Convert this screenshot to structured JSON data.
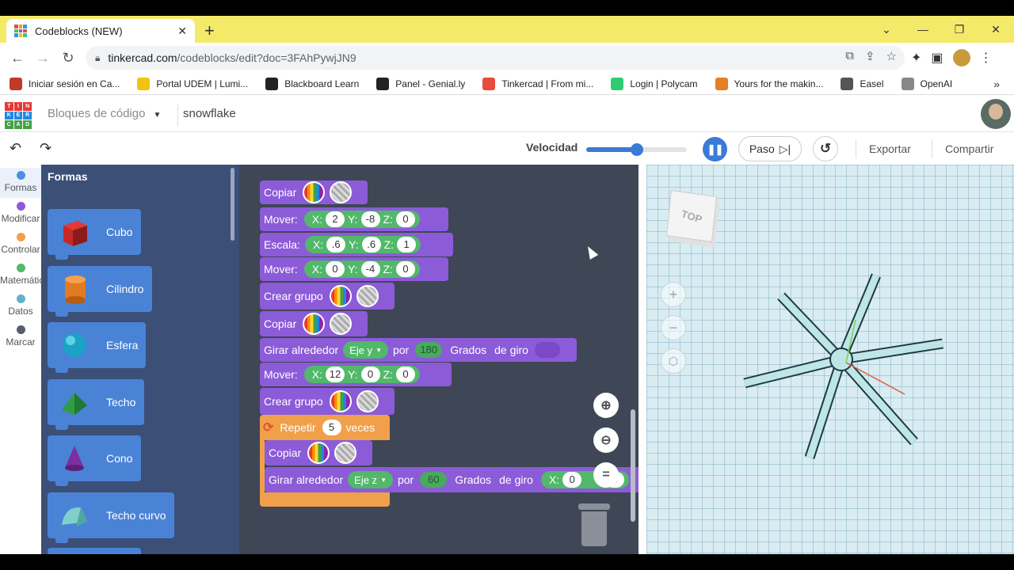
{
  "browser": {
    "tab_title": "Codeblocks (NEW)",
    "url_host": "tinkercad.com",
    "url_path": "/codeblocks/edit?doc=3FAhPywjJN9",
    "bookmarks": [
      "Iniciar sesión en Ca...",
      "Portal UDEM | Lumi...",
      "Blackboard Learn",
      "Panel - Genial.ly",
      "Tinkercad | From mi...",
      "Login | Polycam",
      "Yours for the makin...",
      "Easel",
      "OpenAI"
    ],
    "bookmark_colors": [
      "#c0392b",
      "#f1c40f",
      "#222222",
      "#222222",
      "#e74c3c",
      "#2ecc71",
      "#e67e22",
      "#555555",
      "#888888"
    ]
  },
  "app": {
    "logo_letters": [
      "TIN",
      "KER",
      "CAD"
    ],
    "mode": "Bloques de código",
    "doc_name": "snowflake",
    "velocidad_label": "Velocidad",
    "speed_level": 0.5,
    "paso_label": "Paso",
    "exportar": "Exportar",
    "compartir": "Compartir"
  },
  "categories": [
    {
      "label": "Formas",
      "color": "#4a90e2"
    },
    {
      "label": "Modificar",
      "color": "#8c5bd8"
    },
    {
      "label": "Controlar",
      "color": "#f0a04b"
    },
    {
      "label": "Matemátic",
      "color": "#52b86a"
    },
    {
      "label": "Datos",
      "color": "#5fb4c9"
    },
    {
      "label": "Marcar",
      "color": "#555e6b"
    }
  ],
  "flyout": {
    "title": "Formas",
    "shapes": [
      {
        "label": "Cubo",
        "icon": "cube-icon"
      },
      {
        "label": "Cilindro",
        "icon": "cylinder-icon"
      },
      {
        "label": "Esfera",
        "icon": "sphere-icon"
      },
      {
        "label": "Techo",
        "icon": "roof-icon"
      },
      {
        "label": "Cono",
        "icon": "cone-icon"
      },
      {
        "label": "Techo curvo",
        "icon": "curved-roof-icon"
      }
    ]
  },
  "blocks": {
    "b1": {
      "label": "Copiar"
    },
    "b2": {
      "label": "Mover:",
      "x": "2",
      "y": "-8",
      "z": "0"
    },
    "b3": {
      "label": "Escala:",
      "x": ".6",
      "y": ".6",
      "z": "1"
    },
    "b4": {
      "label": "Mover:",
      "x": "0",
      "y": "-4",
      "z": "0"
    },
    "b5": {
      "label": "Crear grupo"
    },
    "b6": {
      "label": "Copiar"
    },
    "b7": {
      "label": "Girar alrededor",
      "axis": "Eje y",
      "por": "por",
      "deg": "180",
      "grados": "Grados",
      "degiro": "de giro"
    },
    "b8": {
      "label": "Mover:",
      "x": "12",
      "y": "0",
      "z": "0"
    },
    "b9": {
      "label": "Crear grupo"
    },
    "b10": {
      "label": "Repetir",
      "times": "5",
      "veces": "veces"
    },
    "b11": {
      "label": "Copiar"
    },
    "b12": {
      "label": "Girar alrededor",
      "axis": "Eje z",
      "por": "por",
      "deg": "60",
      "grados": "Grados",
      "degiro": "de giro",
      "x": "0",
      "last": "0"
    },
    "axis_x": "X:",
    "axis_y": "Y:",
    "axis_z": "Z:"
  },
  "viewport": {
    "cube_label": "TOP"
  }
}
